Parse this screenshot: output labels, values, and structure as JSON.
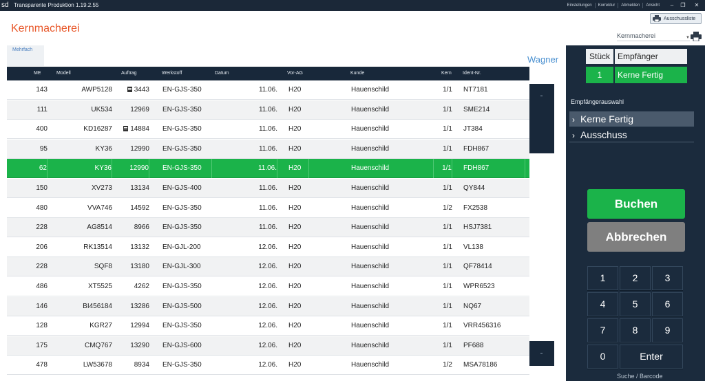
{
  "window": {
    "logo": "sd",
    "title": "Transparente Produktion 1.19.2.55",
    "links": [
      "Einstellungen",
      "Korrektur",
      "Abmelden",
      "Ansicht"
    ],
    "controls": [
      "–",
      "❐",
      "✕"
    ]
  },
  "header": {
    "page_title": "Kernmacherei",
    "ausschuss_button": "Ausschussliste",
    "department_select": "Kernmacherei",
    "user": "Wagner"
  },
  "tabs": {
    "mehrfach": "Mehrfach"
  },
  "table": {
    "columns": [
      "ME",
      "Modell",
      "Auftrag",
      "Werkstoff",
      "Datum",
      "Vor-AG",
      "Kunde",
      "Kern",
      "Ident-Nr."
    ],
    "rows": [
      {
        "me": "143",
        "modell": "AWP5128",
        "auftrag": "3443",
        "doc": true,
        "werkstoff": "EN-GJS-350",
        "datum": "11.06.",
        "vorag": "H20",
        "kunde": "Hauenschild",
        "kern": "1/1",
        "ident": "NT7181"
      },
      {
        "me": "111",
        "modell": "UK534",
        "auftrag": "12969",
        "doc": false,
        "werkstoff": "EN-GJS-350",
        "datum": "11.06.",
        "vorag": "H20",
        "kunde": "Hauenschild",
        "kern": "1/1",
        "ident": "SME214"
      },
      {
        "me": "400",
        "modell": "KD16287",
        "auftrag": "14884",
        "doc": true,
        "werkstoff": "EN-GJS-350",
        "datum": "11.06.",
        "vorag": "H20",
        "kunde": "Hauenschild",
        "kern": "1/1",
        "ident": "JT384"
      },
      {
        "me": "95",
        "modell": "KY36",
        "auftrag": "12990",
        "doc": false,
        "werkstoff": "EN-GJS-350",
        "datum": "11.06.",
        "vorag": "H20",
        "kunde": "Hauenschild",
        "kern": "1/1",
        "ident": "FDH867"
      },
      {
        "me": "62",
        "modell": "KY36",
        "auftrag": "12990",
        "doc": false,
        "werkstoff": "EN-GJS-350",
        "datum": "11.06.",
        "vorag": "H20",
        "kunde": "Hauenschild",
        "kern": "1/1",
        "ident": "FDH867",
        "selected": true
      },
      {
        "me": "150",
        "modell": "XV273",
        "auftrag": "13134",
        "doc": false,
        "werkstoff": "EN-GJS-400",
        "datum": "11.06.",
        "vorag": "H20",
        "kunde": "Hauenschild",
        "kern": "1/1",
        "ident": "QY844"
      },
      {
        "me": "480",
        "modell": "VVA746",
        "auftrag": "14592",
        "doc": false,
        "werkstoff": "EN-GJS-350",
        "datum": "11.06.",
        "vorag": "H20",
        "kunde": "Hauenschild",
        "kern": "1/2",
        "ident": "FX2538"
      },
      {
        "me": "228",
        "modell": "AG8514",
        "auftrag": "8966",
        "doc": false,
        "werkstoff": "EN-GJS-350",
        "datum": "11.06.",
        "vorag": "H20",
        "kunde": "Hauenschild",
        "kern": "1/1",
        "ident": "HSJ7381"
      },
      {
        "me": "206",
        "modell": "RK13514",
        "auftrag": "13132",
        "doc": false,
        "werkstoff": "EN-GJL-200",
        "datum": "12.06.",
        "vorag": "H20",
        "kunde": "Hauenschild",
        "kern": "1/1",
        "ident": "VL138"
      },
      {
        "me": "228",
        "modell": "SQF8",
        "auftrag": "13180",
        "doc": false,
        "werkstoff": "EN-GJL-300",
        "datum": "12.06.",
        "vorag": "H20",
        "kunde": "Hauenschild",
        "kern": "1/1",
        "ident": "QF78414"
      },
      {
        "me": "486",
        "modell": "XT5525",
        "auftrag": "4262",
        "doc": false,
        "werkstoff": "EN-GJS-350",
        "datum": "12.06.",
        "vorag": "H20",
        "kunde": "Hauenschild",
        "kern": "1/1",
        "ident": "WPR6523"
      },
      {
        "me": "146",
        "modell": "BI456184",
        "auftrag": "13286",
        "doc": false,
        "werkstoff": "EN-GJS-500",
        "datum": "12.06.",
        "vorag": "H20",
        "kunde": "Hauenschild",
        "kern": "1/1",
        "ident": "NQ67"
      },
      {
        "me": "128",
        "modell": "KGR27",
        "auftrag": "12994",
        "doc": false,
        "werkstoff": "EN-GJS-350",
        "datum": "12.06.",
        "vorag": "H20",
        "kunde": "Hauenschild",
        "kern": "1/1",
        "ident": "VRR456316"
      },
      {
        "me": "175",
        "modell": "CMQ767",
        "auftrag": "13290",
        "doc": false,
        "werkstoff": "EN-GJS-600",
        "datum": "12.06.",
        "vorag": "H20",
        "kunde": "Hauenschild",
        "kern": "1/1",
        "ident": "PF688"
      },
      {
        "me": "478",
        "modell": "LW53678",
        "auftrag": "8934",
        "doc": false,
        "werkstoff": "EN-GJS-350",
        "datum": "12.06.",
        "vorag": "H20",
        "kunde": "Hauenschild",
        "kern": "1/2",
        "ident": "MSA78186"
      }
    ]
  },
  "booking": {
    "stueck_label": "Stück",
    "empfaenger_label": "Empfänger",
    "stueck_value": "1",
    "empfaenger_value": "Kerne Fertig",
    "selection_label": "Empfängerauswahl",
    "options": [
      "Kerne Fertig",
      "Ausschuss"
    ],
    "buchen": "Buchen",
    "abbrechen": "Abbrechen",
    "keys": [
      "1",
      "2",
      "3",
      "4",
      "5",
      "6",
      "7",
      "8",
      "9",
      "0",
      "Enter"
    ],
    "barcode_label": "Suche / Barcode"
  },
  "colors": {
    "accent_orange": "#e8582a",
    "selected_green": "#1bb34a",
    "dark_navy": "#1b2b3d",
    "cancel_gray": "#7f7f7f"
  }
}
